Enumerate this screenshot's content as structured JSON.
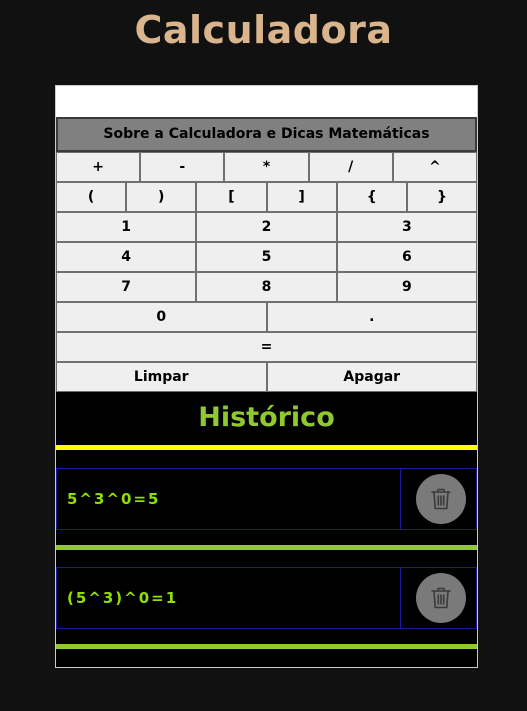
{
  "app": {
    "title": "Calculadora"
  },
  "display": {
    "value": "",
    "placeholder": ""
  },
  "about_button": {
    "label": "Sobre a Calculadora e Dicas Matemáticas"
  },
  "keypad": {
    "operators": [
      "+",
      "-",
      "*",
      "/",
      "^"
    ],
    "brackets": [
      "(",
      ")",
      "[",
      "]",
      "{",
      "}"
    ],
    "digits_row1": [
      "1",
      "2",
      "3"
    ],
    "digits_row2": [
      "4",
      "5",
      "6"
    ],
    "digits_row3": [
      "7",
      "8",
      "9"
    ],
    "zero": "0",
    "decimal": ".",
    "equals": "=",
    "clear": "Limpar",
    "delete": "Apagar"
  },
  "history": {
    "title": "Histórico",
    "items": [
      {
        "expression": "5^3^0=5",
        "delete_icon": "trash-icon"
      },
      {
        "expression": "(5^3)^0=1",
        "delete_icon": "trash-icon"
      }
    ]
  },
  "colors": {
    "background": "#111111",
    "title": "#d9b48c",
    "history_title": "#8fc92f",
    "history_text": "#8fe000",
    "history_separator_top": "#ffff00",
    "history_separator": "#8fc92f",
    "history_border": "#1a1aa0",
    "delete_button": "#7a7a7a"
  }
}
